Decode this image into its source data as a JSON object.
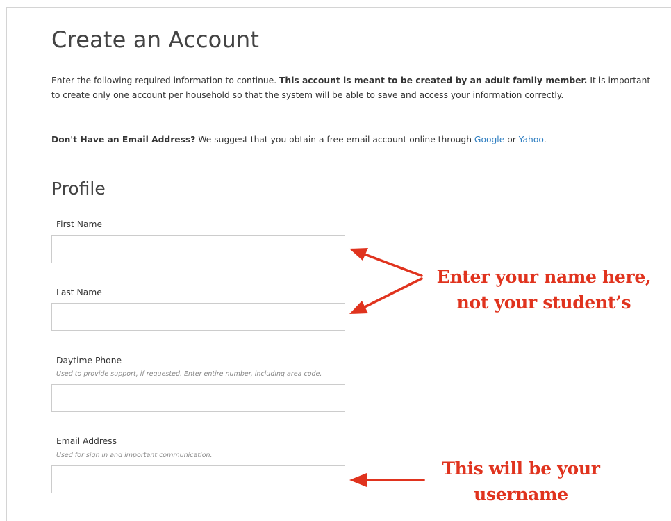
{
  "page": {
    "title": "Create an Account",
    "intro": {
      "text_1": "Enter the following required information to continue. ",
      "bold": "This account is meant to be created by an adult family member.",
      "text_2": " It is important to create only one account per household so that the system will be able to save and access your information correctly."
    },
    "email_note": {
      "bold": "Don't Have an Email Address?",
      "text_1": " We suggest that you obtain a free email account online through ",
      "link_google": "Google",
      "text_2": " or ",
      "link_yahoo": "Yahoo",
      "text_3": "."
    }
  },
  "profile": {
    "heading": "Profile",
    "first_name": {
      "label": "First Name",
      "value": ""
    },
    "last_name": {
      "label": "Last Name",
      "value": ""
    },
    "daytime_phone": {
      "label": "Daytime Phone",
      "help": "Used to provide support, if requested. Enter entire number, including area code.",
      "value": ""
    },
    "email": {
      "label": "Email Address",
      "help": "Used for sign in and important communication.",
      "value": ""
    }
  },
  "annotations": {
    "name_line_1": "Enter your name here,",
    "name_line_2": "not your student’s",
    "username_line_1": "This will be your",
    "username_line_2": "username",
    "color": "#e0331e"
  },
  "colors": {
    "link": "#2a7bbf",
    "input_border": "#cccccc",
    "text": "#333333"
  }
}
